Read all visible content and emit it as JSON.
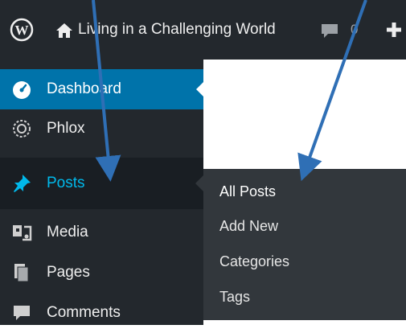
{
  "admin_bar": {
    "site_title": "Living in a Challenging World",
    "comment_count": "0",
    "icons": {
      "logo": "wordpress-logo-icon",
      "home": "home-icon",
      "comments": "comment-bubble-icon",
      "new": "plus-icon"
    }
  },
  "sidebar": {
    "items": [
      {
        "label": "Dashboard",
        "icon": "dashboard-gauge-icon",
        "state": "active"
      },
      {
        "label": "Phlox",
        "icon": "gear-flower-icon"
      },
      {
        "label": "Posts",
        "icon": "pushpin-icon",
        "state": "hover"
      },
      {
        "label": "Media",
        "icon": "media-icon"
      },
      {
        "label": "Pages",
        "icon": "pages-icon"
      },
      {
        "label": "Comments",
        "icon": "comment-bubble-icon"
      }
    ]
  },
  "posts_submenu": {
    "items": [
      "All Posts",
      "Add New",
      "Categories",
      "Tags"
    ]
  },
  "colors": {
    "admin_bar_bg": "#23282d",
    "sidebar_bg": "#23282d",
    "active_bg": "#0073aa",
    "hover_bg": "#191e23",
    "submenu_bg": "#32373c",
    "posts_text": "#00b9eb",
    "arrow": "#2f6fb5"
  }
}
